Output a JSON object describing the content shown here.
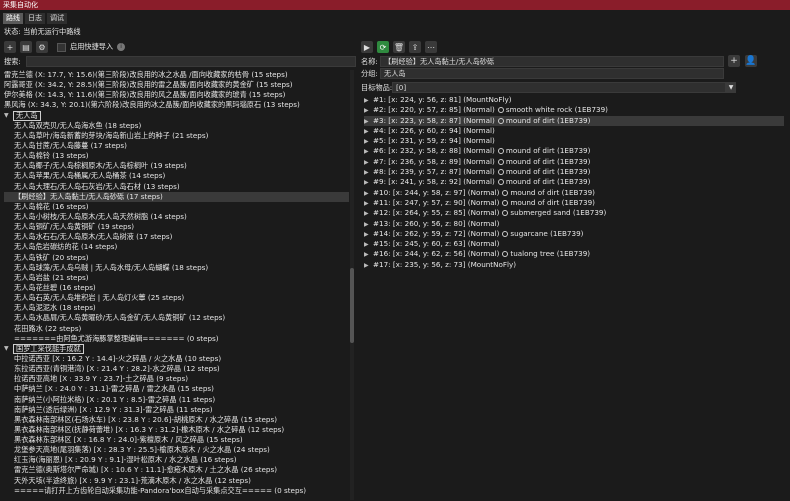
{
  "window": {
    "title": "采集自动化"
  },
  "tabs": [
    "路线",
    "日志",
    "调试"
  ],
  "status": "状态:  当前无运行中路线",
  "left_toolbar": {
    "auto_import_label": "启用快捷导入"
  },
  "search": {
    "label": "搜索:",
    "value": ""
  },
  "left_rows_top": [
    "雷克兰德 (X: 17.7, Y: 15.6)(第三阶段)改良用的冰之水晶 /面向收藏家的枯骨 (15 steps)",
    "阿露哥亚 (X: 34.2, Y: 28.5)(第三阶段)改良用的雷之晶簇/面向收藏家的黄金矿 (15 steps)",
    "伊尔美格 (X: 14.3, Y: 11.6)(第三阶段)改良用的风之晶簇/面向收藏家的琥青 (15 steps)",
    "黑风海 (X: 34.3, Y: 20.1)(第六阶段)改良用的冰之晶簇/面向收藏家的黑玛瑙原石 (13 steps)"
  ],
  "group1": {
    "label": "无人岛"
  },
  "group1_rows": [
    "无人岛双壳贝/无人岛海水鱼 (18 steps)",
    "无人岛草叶/海岛新蓄的芽块/海岛新山岩上的种子 (21 steps)",
    "无人岛甘蔗/无人岛藤蔓 (17 steps)",
    "无人岛棉铃 (13 steps)",
    "无人岛椰子/无人岛棕榈原木/无人岛棕榈叶 (19 steps)",
    "无人岛苹果/无人岛桶属/无人岛桶茶 (14 steps)",
    "无人岛大理石/无人岛石灰岩/无人岛石材 (13 steps)",
    "【刷经验】无人岛黏土/无人岛砂砾 (17 steps)",
    "无人岛棉花 (16 steps)",
    "无人岛小树枝/无人岛原木/无人岛天然树脂 (14 steps)",
    "无人岛铜矿/无人岛黄铜矿 (19 steps)",
    "无人岛水石石/无人岛原木/无人岛树液 (17 steps)",
    "无人岛危岩碳纺的花 (14 steps)",
    "无人岛铁矿 (20 steps)",
    "无人岛球藻/无人岛乌贼 | 无人岛水母/无人岛蝴蝶 (18 steps)",
    "无人岛岩盐 (21 steps)",
    "无人岛花丝碧 (16 steps)",
    "无人岛石英/无人岛堆积岩 | 无人岛灯火蕈 (25 steps)",
    "无人岛泥泥水 (18 steps)",
    "无人岛水晶屑/无人岛黄曜砂/无人岛金矿/无人岛黄铜矿 (12 steps)",
    "花田路水 (22 steps)",
    "=======由阿鱼尤游海豚掌整理编辑======= (0 steps)"
  ],
  "group2": {
    "label": "国罗工采伐能手成就"
  },
  "group2_rows": [
    "中拉诺西亚 [X : 16.2 Y : 14.4]-火之碎晶 / 火之水晶 (10 steps)",
    "东拉诺西亚(青铜港湾) [X : 21.4 Y : 28.2]-水之碎晶 (12 steps)",
    "拉诺西亚高地 [X : 33.9 Y : 23.7]-土之碎晶 (9 steps)",
    "中萨纳兰 [X : 24.0 Y : 31.1]-雷之碎晶 / 雷之水晶 (15 steps)",
    "南萨纳兰(小阿拉米格) [X : 20.1 Y : 8.5]-雷之碎晶 (11 steps)",
    "南萨纳兰(透后绿洲) [X : 12.9 Y : 31.3]-雷之碎晶 (11 steps)",
    "黑衣森林南部林区(石场水车) [X : 23.8 Y : 20.6]-胡桃原木 / 水之碎晶 (15 steps)",
    "黑衣森林南部林区(抚静荷蕾堆) [X : 16.3 Y : 31.2]-橡木原木 / 水之碎晶 (12 steps)",
    "黑衣森林东部林区 [X : 16.8 Y : 24.0]-紫檀原木 / 风之碎晶 (15 steps)",
    "龙堡参天高地(尾羽集落) [X : 28.3 Y : 25.5]-榆原木原木 / 火之水晶 (24 steps)",
    "红玉海(海丽恩) [X : 20.9 Y : 9.1]-湿叶松原木 / 水之水晶 (16 steps)",
    "雷克兰德(奥斯塔尔严命城) [X : 10.6 Y : 11.1]-愈疮木原木 / 土之水晶 (26 steps)",
    "天外天垓(半途终旅) [X : 9.9 Y : 23.1]-荒滴木原木 / 水之水晶 (12 steps)",
    "=====请打开上方齿轮自动采集功能-Pandora'box自动与采集点交互===== (0 steps)"
  ],
  "form": {
    "name_label": "名称:",
    "name_value": "【刷经验】无人岛黏土/无人岛砂砾",
    "group_label": "分组:",
    "group_value": "无人岛",
    "target_label": "目标物品:",
    "target_value": "[0]"
  },
  "steps": [
    {
      "text": "#1: [x: 224, y: 56, z: 81] (MountNoFly)",
      "marker": ""
    },
    {
      "text": "#2: [x: 220, y: 57, z: 85] (Normal)",
      "marker": "smooth white rock (1EB739)"
    },
    {
      "text": "#3: [x: 223, y: 58, z: 87] (Normal)",
      "marker": "mound of dirt (1EB739)"
    },
    {
      "text": "#4: [x: 226, y: 60, z: 94] (Normal)",
      "marker": ""
    },
    {
      "text": "#5: [x: 231, y: 59, z: 94] (Normal)",
      "marker": ""
    },
    {
      "text": "#6: [x: 232, y: 58, z: 88] (Normal)",
      "marker": "mound of dirt (1EB739)"
    },
    {
      "text": "#7: [x: 236, y: 58, z: 89] (Normal)",
      "marker": "mound of dirt (1EB739)"
    },
    {
      "text": "#8: [x: 239, y: 57, z: 87] (Normal)",
      "marker": "mound of dirt (1EB739)"
    },
    {
      "text": "#9: [x: 241, y: 58, z: 92] (Normal)",
      "marker": "mound of dirt (1EB739)"
    },
    {
      "text": "#10: [x: 244, y: 58, z: 97] (Normal)",
      "marker": "mound of dirt (1EB739)"
    },
    {
      "text": "#11: [x: 247, y: 57, z: 90] (Normal)",
      "marker": "mound of dirt (1EB739)"
    },
    {
      "text": "#12: [x: 264, y: 55, z: 85] (Normal)",
      "marker": "submerged sand (1EB739)"
    },
    {
      "text": "#13: [x: 260, y: 56, z: 80] (Normal)",
      "marker": ""
    },
    {
      "text": "#14: [x: 262, y: 59, z: 72] (Normal)",
      "marker": "sugarcane (1EB739)"
    },
    {
      "text": "#15: [x: 245, y: 60, z: 63] (Normal)",
      "marker": ""
    },
    {
      "text": "#16: [x: 244, y: 62, z: 56] (Normal)",
      "marker": "tualong tree (1EB739)"
    },
    {
      "text": "#17: [x: 235, y: 56, z: 73] (MountNoFly)",
      "marker": ""
    }
  ],
  "colors": {
    "titlebar": "#8a1d2a",
    "refresh": "#2f8a3f",
    "selection": "#3a3a3a"
  }
}
